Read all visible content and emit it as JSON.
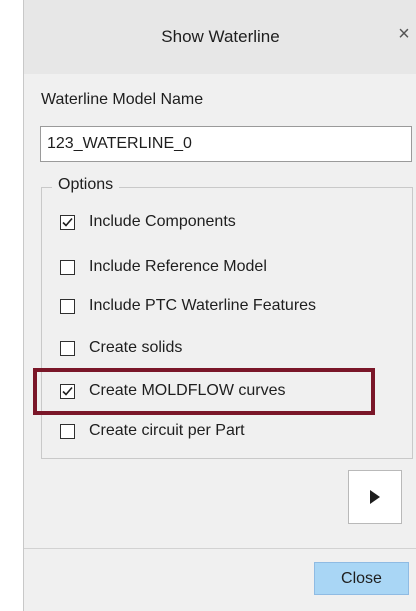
{
  "dialog": {
    "title": "Show Waterline",
    "close_glyph": "×"
  },
  "model_name": {
    "label": "Waterline Model Name",
    "value": "123_WATERLINE_0"
  },
  "options": {
    "legend": "Options",
    "items": [
      {
        "label": "Include Components",
        "checked": true
      },
      {
        "label": "Include Reference Model",
        "checked": false
      },
      {
        "label": "Include PTC Waterline Features",
        "checked": false
      },
      {
        "label": "Create solids",
        "checked": false
      },
      {
        "label": "Create MOLDFLOW curves",
        "checked": true,
        "highlighted": true
      },
      {
        "label": "Create circuit per Part",
        "checked": false
      }
    ]
  },
  "buttons": {
    "run_icon": "play-arrow-icon",
    "close_label": "Close"
  },
  "colors": {
    "highlight": "#7a1628",
    "close_button": "#a9d6f5"
  }
}
